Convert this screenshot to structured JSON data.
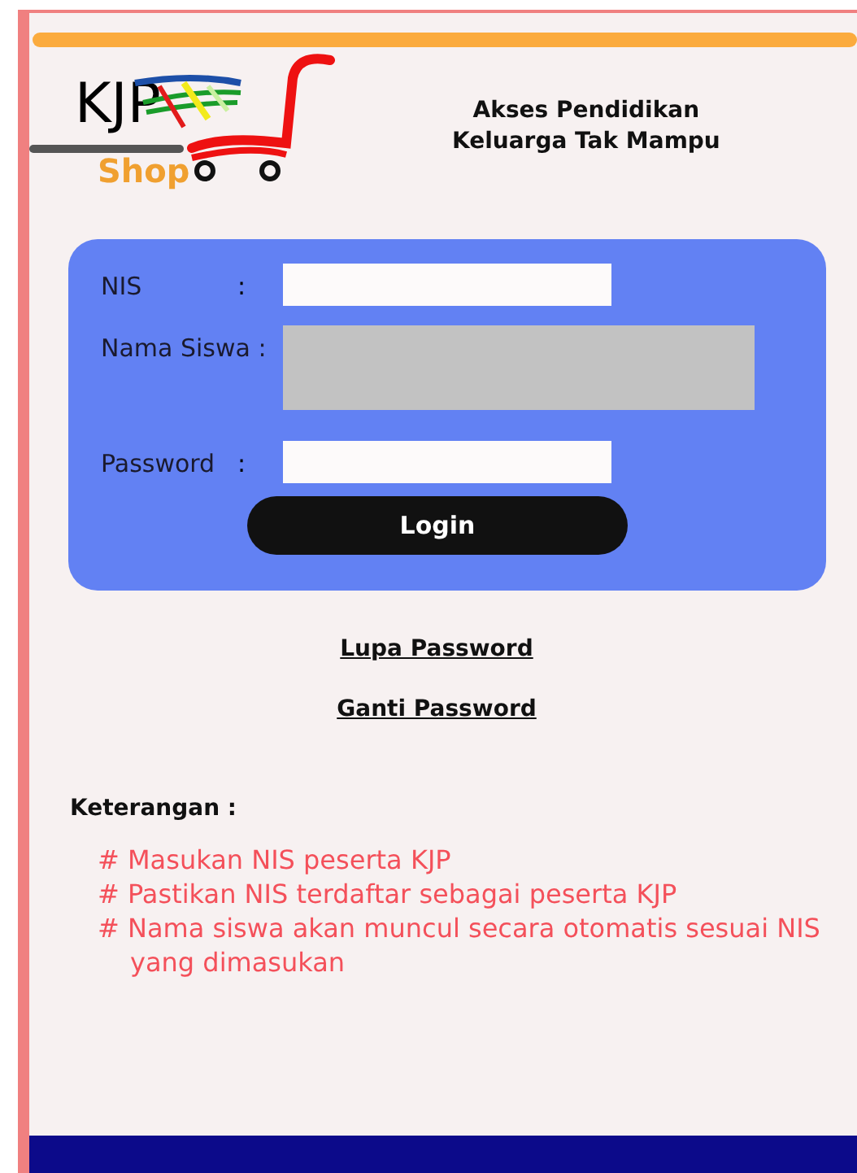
{
  "logo": {
    "title": "KJP",
    "subtitle": "Shop"
  },
  "header": {
    "lines": [
      "Akses Pendidikan",
      "Keluarga Tak Mampu"
    ]
  },
  "form": {
    "fields": [
      {
        "label": "NIS",
        "separator": ":",
        "kind": "text",
        "disabled": false
      },
      {
        "label": "Nama Siswa :",
        "kind": "multiline",
        "disabled": true
      },
      {
        "label": "Password",
        "separator": ":",
        "kind": "password",
        "disabled": false
      }
    ],
    "submit": "Login"
  },
  "links": [
    "Lupa Password",
    "Ganti Password"
  ],
  "notes": {
    "title": "Keterangan :",
    "items": [
      "# Masukan NIS peserta KJP",
      "# Pastikan NIS terdaftar sebagai peserta KJP",
      "# Nama siswa akan muncul secara otomatis sesuai NIS yang dimasukan"
    ]
  }
}
